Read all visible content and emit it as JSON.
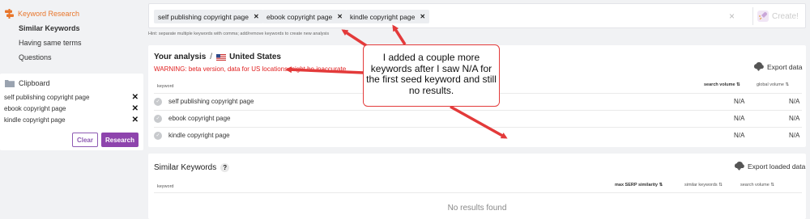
{
  "sidebar": {
    "title": "Keyword Research",
    "items": [
      {
        "label": "Similar Keywords",
        "active": true
      },
      {
        "label": "Having same terms",
        "active": false
      },
      {
        "label": "Questions",
        "active": false
      }
    ],
    "clipboard": {
      "title": "Clipboard",
      "items": [
        "self publishing copyright page",
        "ebook copyright page",
        "kindle copyright page"
      ],
      "clear_label": "Clear",
      "research_label": "Research"
    }
  },
  "top": {
    "chips": [
      "self publishing copyright page",
      "ebook copyright page",
      "kindle copyright page"
    ],
    "clear_all_glyph": "×",
    "create_label": "Create!",
    "hint": "Hint: separate multiple keywords with comma; add/remove keywords to create new analysis"
  },
  "analysis": {
    "title": "Your analysis",
    "separator": "/",
    "location": "United States",
    "warning": "WARNING: beta version, data for US locations might be inaccurate",
    "export_label": "Export data",
    "columns": {
      "keyword": "keyword",
      "search_volume": "search volume",
      "global_volume": "global volume"
    },
    "rows": [
      {
        "keyword": "self publishing copyright page",
        "search_volume": "N/A",
        "global_volume": "N/A"
      },
      {
        "keyword": "ebook copyright page",
        "search_volume": "N/A",
        "global_volume": "N/A"
      },
      {
        "keyword": "kindle copyright page",
        "search_volume": "N/A",
        "global_volume": "N/A"
      }
    ]
  },
  "similar": {
    "title": "Similar Keywords",
    "help_glyph": "?",
    "export_label": "Export loaded data",
    "columns": {
      "keyword": "keyword",
      "max_serp": "max SERP similarity",
      "similar_keywords": "similar keywords",
      "search_volume": "search volume"
    },
    "empty": "No results found"
  },
  "annotation": {
    "text": "I added a couple more keywords after I saw N/A for the first seed keyword and still no results.",
    "color": "#e33a3a"
  },
  "colors": {
    "accent": "#e8762b",
    "brand": "#8e44ad",
    "warning": "#e02020"
  }
}
